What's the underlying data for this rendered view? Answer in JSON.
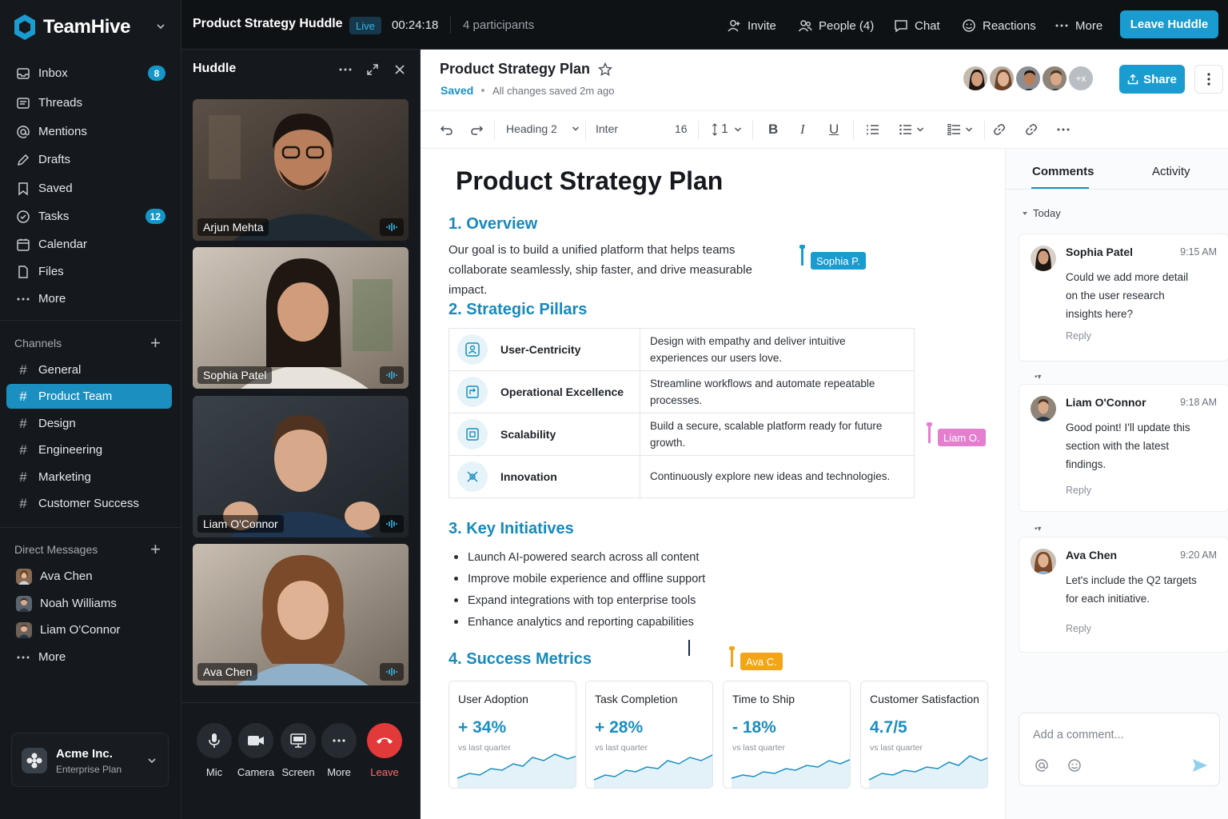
{
  "app": {
    "name": "TeamHive"
  },
  "sidebar": {
    "nav": [
      {
        "label": "Inbox",
        "icon": "inbox-icon",
        "badge": "8"
      },
      {
        "label": "Threads",
        "icon": "threads-icon",
        "badge": ""
      },
      {
        "label": "Mentions",
        "icon": "at-icon",
        "badge": ""
      },
      {
        "label": "Drafts",
        "icon": "pencil-icon",
        "badge": ""
      },
      {
        "label": "Saved",
        "icon": "bookmark-icon",
        "badge": ""
      },
      {
        "label": "Tasks",
        "icon": "check-circle-icon",
        "badge": "12"
      },
      {
        "label": "Calendar",
        "icon": "calendar-icon",
        "badge": ""
      },
      {
        "label": "Files",
        "icon": "file-icon",
        "badge": ""
      },
      {
        "label": "More",
        "icon": "ellipsis-icon",
        "badge": ""
      }
    ],
    "channels_title": "Channels",
    "channels": [
      "General",
      "Product Team",
      "Design",
      "Engineering",
      "Marketing",
      "Customer Success"
    ],
    "active_channel": "Product Team",
    "dm_title": "Direct Messages",
    "dms": [
      "Ava Chen",
      "Noah Williams",
      "Liam O'Connor",
      "More"
    ],
    "org": {
      "name": "Acme Inc.",
      "plan": "Enterprise Plan"
    }
  },
  "topbar": {
    "title": "Product Strategy Huddle",
    "live": "Live",
    "timer": "00:24:18",
    "participants": "4 participants",
    "invite": "Invite",
    "people": "People (4)",
    "chat": "Chat",
    "reactions": "Reactions",
    "more": "More",
    "leave": "Leave Huddle"
  },
  "huddle": {
    "title": "Huddle",
    "tiles": [
      "Arjun Mehta",
      "Sophia Patel",
      "Liam O'Connor",
      "Ava Chen"
    ],
    "controls": [
      "Mic",
      "Camera",
      "Screen",
      "More",
      "Leave"
    ]
  },
  "doc": {
    "title": "Product Strategy Plan",
    "saved": "Saved",
    "saved_msg": "All changes saved 2m ago",
    "facepile_more": "+x",
    "share": "Share",
    "toolbar": {
      "style": "Heading 2",
      "font": "Inter",
      "size": "16",
      "line": "1"
    },
    "h1": "Product Strategy Plan",
    "overview_h": "1.  Overview",
    "overview_p": "Our goal is to build a unified platform that helps teams collaborate seamlessly, ship faster, and drive measurable impact.",
    "pillars_h": "2. Strategic Pillars",
    "pillars": [
      {
        "name": "User-Centricity",
        "desc": "Design with empathy and deliver intuitive experiences our users love."
      },
      {
        "name": "Operational Excellence",
        "desc": "Streamline workflows and automate repeatable processes."
      },
      {
        "name": "Scalability",
        "desc": "Build a secure, scalable platform ready for future growth."
      },
      {
        "name": "Innovation",
        "desc": "Continuously explore new ideas and technologies."
      }
    ],
    "initiatives_h": "3. Key Initiatives",
    "initiatives": [
      "Launch AI-powered search across all content",
      "Improve mobile experience and offline support",
      "Expand integrations with top enterprise tools",
      "Enhance analytics and reporting capabilities"
    ],
    "metrics_h": "4. Success Metrics",
    "metrics": [
      {
        "title": "User Adoption",
        "value": "+ 34%",
        "sub": "vs last quarter"
      },
      {
        "title": "Task Completion",
        "value": "+ 28%",
        "sub": "vs last quarter"
      },
      {
        "title": "Time to Ship",
        "value": "- 18%",
        "sub": "vs last quarter"
      },
      {
        "title": "Customer Satisfaction",
        "value": "4.7/5",
        "sub": "vs last quarter"
      }
    ],
    "cursors": [
      {
        "label": "Sophia P.",
        "color": "#1a9cd0"
      },
      {
        "label": "Liam O.",
        "color": "#e47fcf"
      },
      {
        "label": "Ava C.",
        "color": "#f2a516"
      }
    ]
  },
  "comments": {
    "tabs": [
      "Comments",
      "Activity"
    ],
    "group": "Today",
    "items": [
      {
        "name": "Sophia Patel",
        "time": "9:15 AM",
        "text": "Could we add more detail on the user research insights here?",
        "reply": "Reply"
      },
      {
        "name": "Liam O'Connor",
        "time": "9:18 AM",
        "text": "Good point! I'll update this section with the latest findings.",
        "reply": "Reply"
      },
      {
        "name": "Ava Chen",
        "time": "9:20 AM",
        "text": "Let's include the Q2 targets for each initiative.",
        "reply": "Reply"
      }
    ],
    "placeholder": "Add a comment..."
  },
  "colors": {
    "accent": "#1a9cd0",
    "heading": "#1789bb",
    "sidebar_bg": "#15191d",
    "leave_red": "#e23a3a"
  }
}
